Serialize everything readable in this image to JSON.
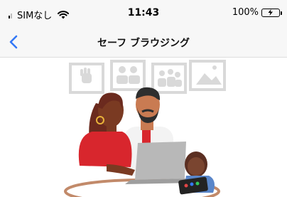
{
  "status_bar": {
    "carrier": "SIMなし",
    "time": "11:43",
    "battery": "100%",
    "battery_level": 1.0,
    "icons": [
      "signal-icon",
      "wifi-icon",
      "battery-charging-icon"
    ]
  },
  "nav": {
    "title": "セーフ ブラウジング",
    "back_icon": "chevron-left-icon"
  },
  "colors": {
    "accent": "#3478f6",
    "battery_green": "#35c759",
    "shirt_red": "#d8262d",
    "frame_gray": "#d9d9d9"
  }
}
